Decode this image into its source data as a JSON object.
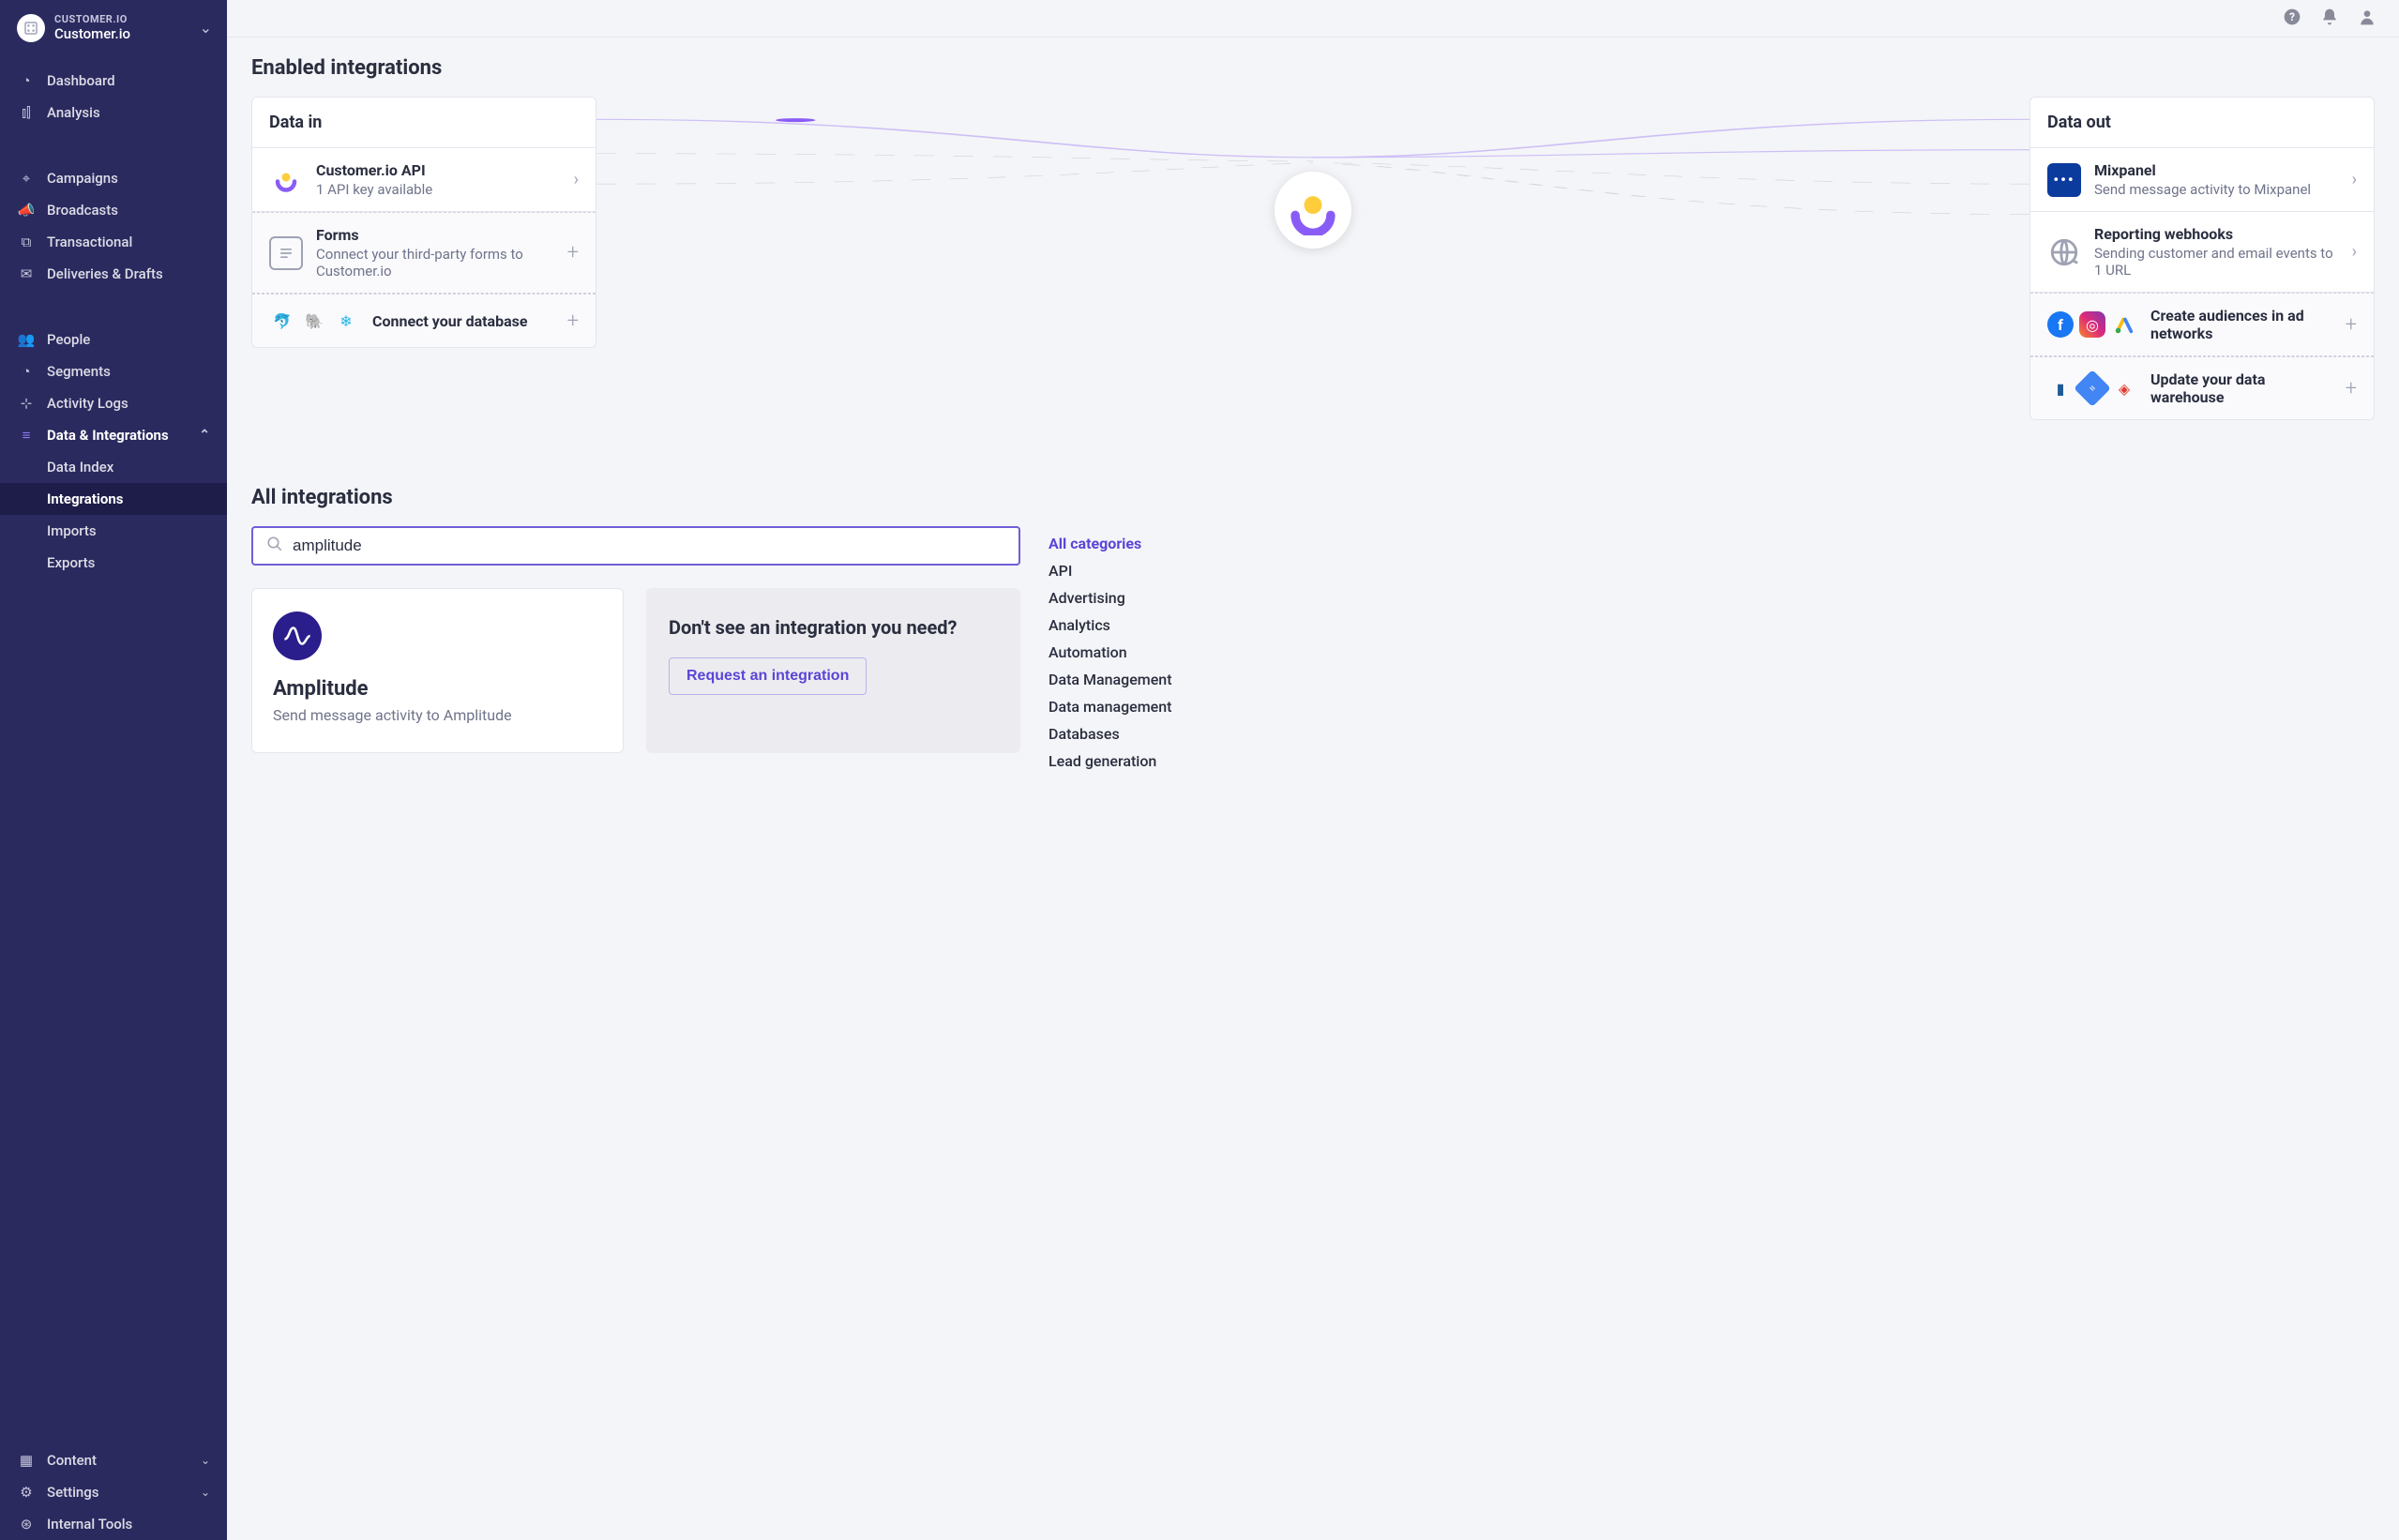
{
  "workspace": {
    "upper": "CUSTOMER.IO",
    "name": "Customer.io"
  },
  "nav": {
    "dashboard": "Dashboard",
    "analysis": "Analysis",
    "campaigns": "Campaigns",
    "broadcasts": "Broadcasts",
    "transactional": "Transactional",
    "deliveries": "Deliveries & Drafts",
    "people": "People",
    "segments": "Segments",
    "activity": "Activity Logs",
    "data_integrations": "Data & Integrations",
    "sub": {
      "data_index": "Data Index",
      "integrations": "Integrations",
      "imports": "Imports",
      "exports": "Exports"
    },
    "content": "Content",
    "settings": "Settings",
    "internal": "Internal Tools"
  },
  "enabled": {
    "heading": "Enabled integrations",
    "data_in": {
      "title": "Data in",
      "api": {
        "title": "Customer.io API",
        "sub": "1 API key available"
      },
      "forms": {
        "title": "Forms",
        "sub": "Connect your third-party forms to Customer.io"
      },
      "db": {
        "title": "Connect your database"
      }
    },
    "data_out": {
      "title": "Data out",
      "mixpanel": {
        "title": "Mixpanel",
        "sub": "Send message activity to Mixpanel"
      },
      "webhooks": {
        "title": "Reporting webhooks",
        "sub": "Sending customer and email events to 1 URL"
      },
      "ads": {
        "title": "Create audiences in ad networks"
      },
      "warehouse": {
        "title": "Update your data warehouse"
      }
    }
  },
  "all": {
    "heading": "All integrations",
    "search_value": "amplitude",
    "result": {
      "title": "Amplitude",
      "sub": "Send message activity to Amplitude"
    },
    "request": {
      "heading": "Don't see an integration you need?",
      "button": "Request an integration"
    },
    "categories": [
      "All categories",
      "API",
      "Advertising",
      "Analytics",
      "Automation",
      "Data Management",
      "Data management",
      "Databases",
      "Lead generation"
    ]
  },
  "colors": {
    "mixpanel": "#0c3b9e",
    "amplitude": "#2a1e8c",
    "accent": "#6e5ed6"
  }
}
